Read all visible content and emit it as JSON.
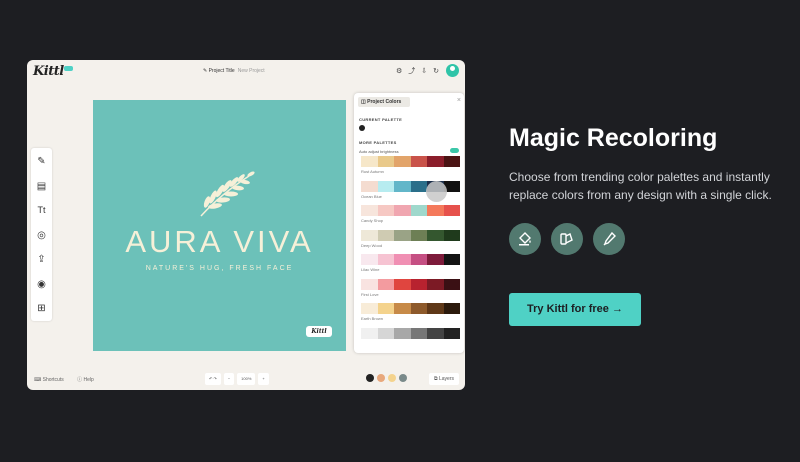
{
  "app": {
    "logo": "Kittl",
    "project_title": "Project Title",
    "project_subtitle": "New Project",
    "top_icons": [
      "settings-icon",
      "share-icon",
      "download-icon",
      "refresh-icon"
    ],
    "tools": [
      "edit-icon",
      "layout-icon",
      "text-icon",
      "shapes-icon",
      "upload-icon",
      "camera-icon",
      "grid-icon"
    ],
    "tool_glyphs": [
      "✎",
      "▤",
      "Tt",
      "◎",
      "⇪",
      "◉",
      "⊞"
    ]
  },
  "canvas": {
    "background": "#6cc1b9",
    "brand": "AURA VIVA",
    "tagline": "NATURE'S HUG, FRESH FACE",
    "watermark": "Kittl"
  },
  "panel": {
    "title": "Project Colors",
    "current_label": "CURRENT PALETTE",
    "more_label": "MORE PALETTES",
    "auto_adjust": "Auto adjust brightness",
    "palettes": [
      {
        "name": "Rust Autumn",
        "colors": [
          "#f6e7c9",
          "#e9c98a",
          "#e2a46a",
          "#c9534a",
          "#8b1e2b",
          "#4b1414"
        ]
      },
      {
        "name": "Ocean Blue",
        "colors": [
          "#f4dcd0",
          "#b7ecf0",
          "#62b6c9",
          "#2a6f8a",
          "#1a2e4a",
          "#111111"
        ]
      },
      {
        "name": "Candy Shop",
        "colors": [
          "#f7e5dc",
          "#f6c8c3",
          "#f0a6b0",
          "#9fd8cc",
          "#f4795b",
          "#e6514c"
        ]
      },
      {
        "name": "Deep Wood",
        "colors": [
          "#eee8d8",
          "#cfcbb2",
          "#9aa386",
          "#6d7f55",
          "#34572f",
          "#1f3a1c"
        ]
      },
      {
        "name": "Lilac Wine",
        "colors": [
          "#f8e8ee",
          "#f6c3d2",
          "#f08fb3",
          "#c54f83",
          "#7d1b3b",
          "#141414"
        ]
      },
      {
        "name": "First Love",
        "colors": [
          "#f9e3e1",
          "#f39b9f",
          "#e0453f",
          "#b8222f",
          "#7c1a25",
          "#3a1014"
        ]
      },
      {
        "name": "Earth Brown",
        "colors": [
          "#f8ecd8",
          "#f4d38d",
          "#c78a48",
          "#8e5a2b",
          "#5f3818",
          "#2c1a0c"
        ]
      },
      {
        "name": "",
        "colors": [
          "#f0f0f0",
          "#d6d6d6",
          "#a8a8a8",
          "#777777",
          "#444444",
          "#222222"
        ]
      }
    ]
  },
  "bottombar": {
    "shortcuts": "Shortcuts",
    "help": "Help",
    "zoom_label": "100%",
    "chip_colors": [
      "#222222",
      "#e8a87c",
      "#f4d38d",
      "#7a8a8a"
    ],
    "layers": "Layers"
  },
  "marketing": {
    "headline": "Magic Recoloring",
    "description": "Choose from trending color palettes and instantly replace colors from any design with a single click.",
    "feature_icons": [
      "paint-bucket-icon",
      "palette-icon",
      "eyedropper-icon"
    ],
    "cta": "Try Kittl for free →"
  }
}
